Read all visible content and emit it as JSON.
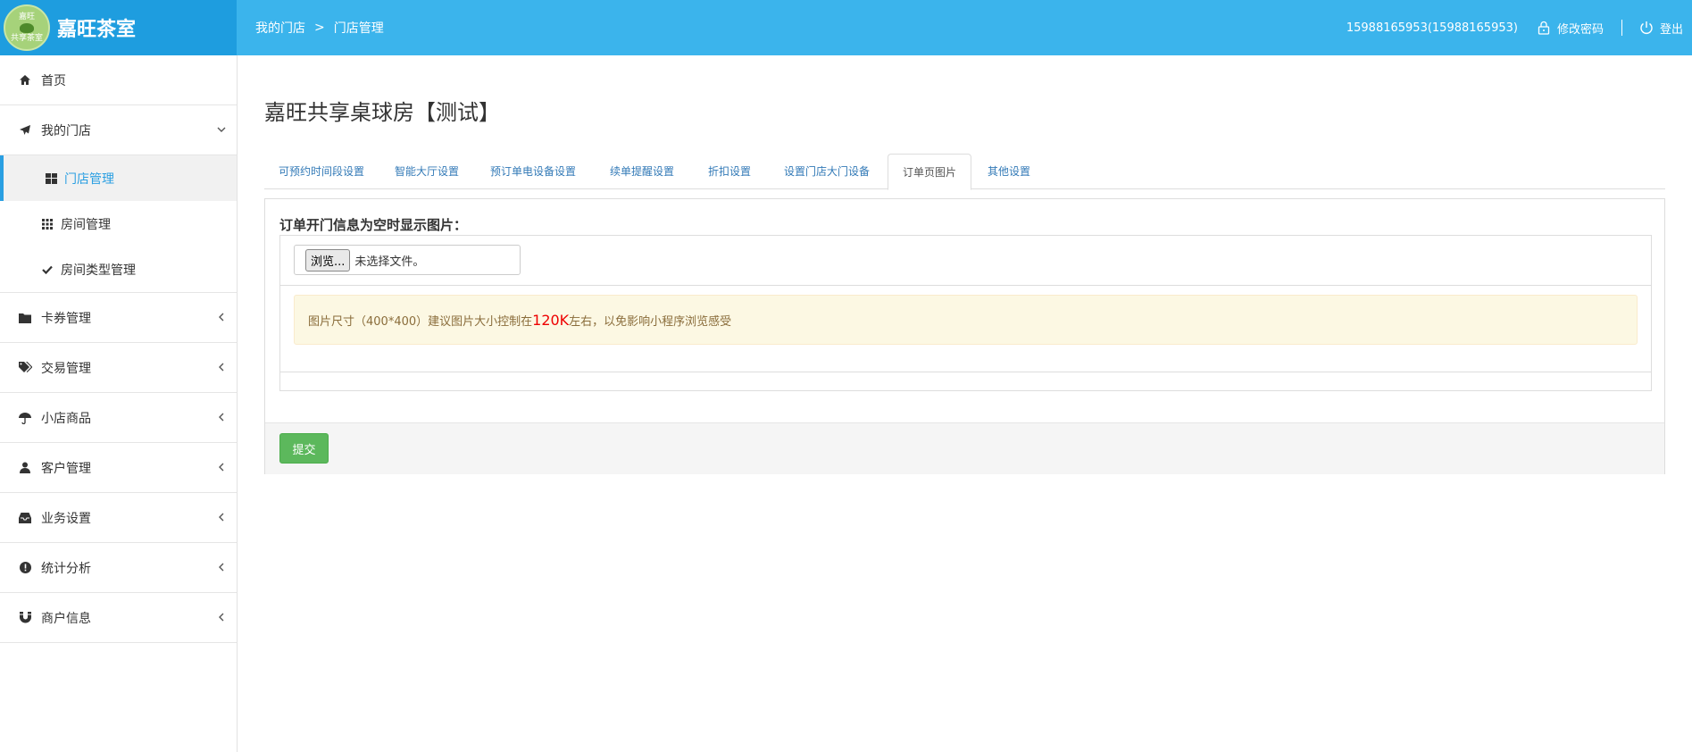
{
  "brand": {
    "logo_top_text": "嘉旺",
    "logo_bottom_text": "共享茶室",
    "name": "嘉旺茶室"
  },
  "breadcrumb": {
    "items": [
      "我的门店",
      "门店管理"
    ],
    "separator": ">"
  },
  "header": {
    "user": "15988165953(15988165953)",
    "change_password": "修改密码",
    "logout": "登出"
  },
  "sidebar": {
    "home": "首页",
    "my_store": "我的门店",
    "sub_items": [
      "门店管理",
      "房间管理",
      "房间类型管理"
    ],
    "items": [
      "卡券管理",
      "交易管理",
      "小店商品",
      "客户管理",
      "业务设置",
      "统计分析",
      "商户信息"
    ]
  },
  "page": {
    "title": "嘉旺共享桌球房【测试】"
  },
  "tabs": [
    "可预约时间段设置",
    "智能大厅设置",
    "预订单电设备设置",
    "续单提醒设置",
    "折扣设置",
    "设置门店大门设备",
    "订单页图片",
    "其他设置"
  ],
  "active_tab": "订单页图片",
  "form": {
    "label": "订单开门信息为空时显示图片：",
    "file_button": "浏览...",
    "file_status": "未选择文件。",
    "hint_prefix": "图片尺寸（400*400）建议图片大小控制在",
    "hint_highlight": "120K",
    "hint_suffix": "左右，以免影响小程序浏览感受",
    "submit": "提交"
  },
  "colors": {
    "header": "#3bb4ec",
    "brand_bg": "#1e9ddf",
    "accent": "#2a9fe2",
    "submit": "#5cb85c",
    "warning_bg": "#fcf8e3",
    "highlight": "#ee0000"
  }
}
